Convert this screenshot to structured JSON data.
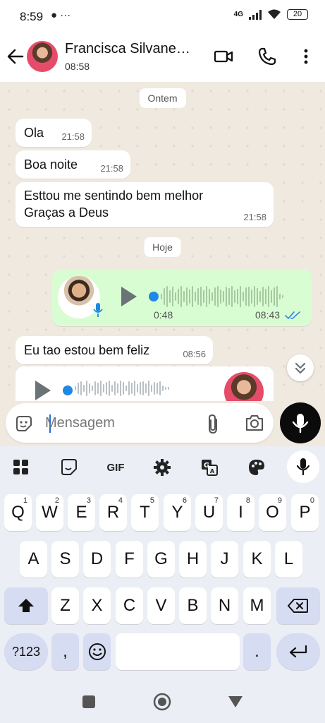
{
  "status_bar": {
    "time": "8:59",
    "left_icons": "● ···",
    "network": "4G",
    "battery": "20"
  },
  "header": {
    "contact_name": "Francisca Silvane…",
    "last_seen": "08:58"
  },
  "chat": {
    "date_yesterday": "Ontem",
    "date_today": "Hoje",
    "messages": [
      {
        "text": "Ola",
        "time": "21:58"
      },
      {
        "text": "Boa noite",
        "time": "21:58"
      },
      {
        "text_line1": "Esttou me sentindo bem melhor",
        "text_line2": "Graças a  Deus",
        "time": "21:58"
      },
      {
        "duration": "0:48",
        "time": "08:43",
        "status": "read"
      },
      {
        "text": "Eu tao estou bem feliz",
        "time": "08:56"
      }
    ]
  },
  "input": {
    "placeholder": "Mensagem"
  },
  "keyboard": {
    "toolbar": [
      "apps-icon",
      "sticker-icon",
      "GIF",
      "gear-icon",
      "translate-icon",
      "palette-icon",
      "mic-icon"
    ],
    "gif_label": "GIF",
    "row1": [
      {
        "k": "Q",
        "n": "1"
      },
      {
        "k": "W",
        "n": "2"
      },
      {
        "k": "E",
        "n": "3"
      },
      {
        "k": "R",
        "n": "4"
      },
      {
        "k": "T",
        "n": "5"
      },
      {
        "k": "Y",
        "n": "6"
      },
      {
        "k": "U",
        "n": "7"
      },
      {
        "k": "I",
        "n": "8"
      },
      {
        "k": "O",
        "n": "9"
      },
      {
        "k": "P",
        "n": "0"
      }
    ],
    "row2": [
      "A",
      "S",
      "D",
      "F",
      "G",
      "H",
      "J",
      "K",
      "L"
    ],
    "row3": [
      "Z",
      "X",
      "C",
      "V",
      "B",
      "N",
      "M"
    ],
    "symbols_label": "?123",
    "comma": ",",
    "period": "."
  }
}
